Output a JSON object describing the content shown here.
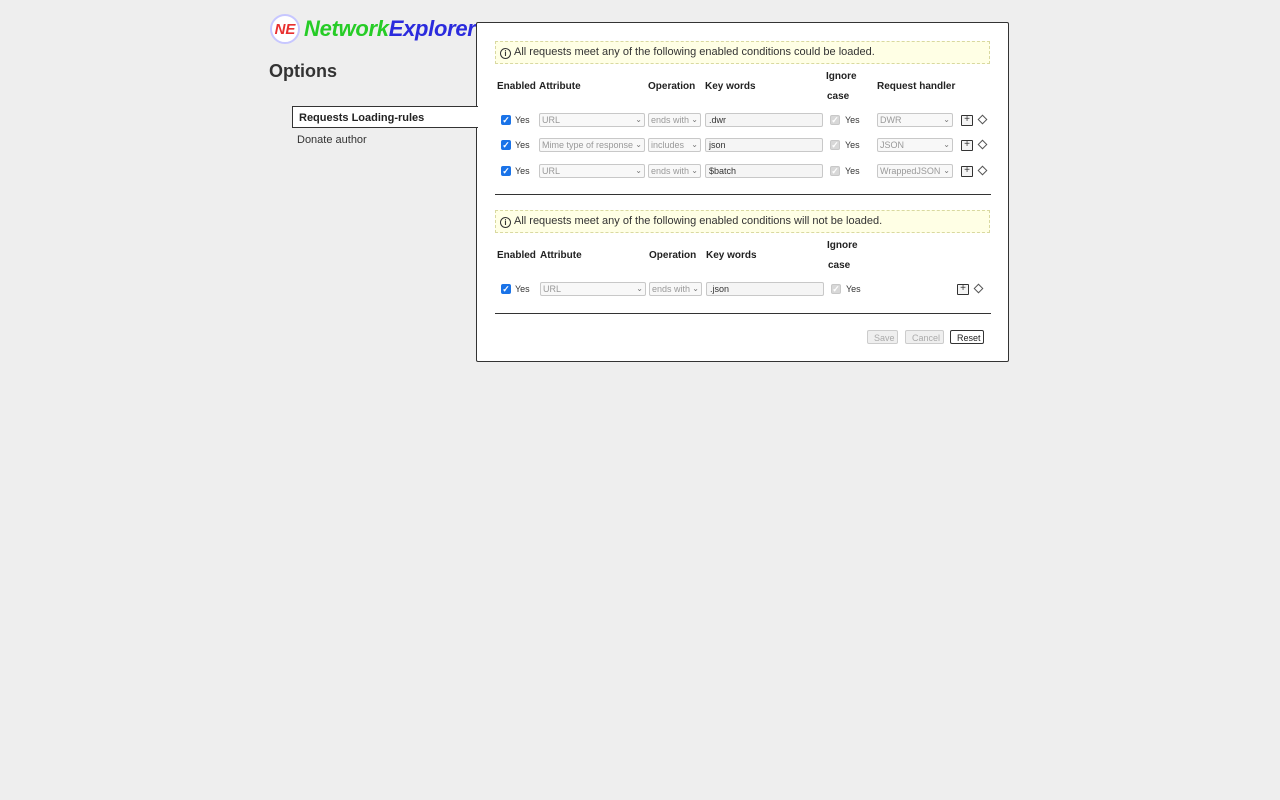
{
  "app": {
    "name_part1": "Network",
    "name_part2": "Explorer",
    "logo_mark": "NE"
  },
  "page_title": "Options",
  "nav": {
    "items": [
      {
        "label": "Requests Loading-rules"
      },
      {
        "label": "Donate author"
      }
    ]
  },
  "load_section": {
    "notice": "All requests meet any of the following enabled conditions could be loaded.",
    "headers": {
      "enabled": "Enabled",
      "attribute": "Attribute",
      "operation": "Operation",
      "keywords": "Key words",
      "ignore_case_1": "Ignore",
      "ignore_case_2": "case",
      "handler": "Request handler"
    },
    "rows": [
      {
        "enabled": "Yes",
        "attribute": "URL",
        "operation": "ends with",
        "keywords": ".dwr",
        "ignore_case": "Yes",
        "handler": "DWR"
      },
      {
        "enabled": "Yes",
        "attribute": "Mime type of response",
        "operation": "includes",
        "keywords": "json",
        "ignore_case": "Yes",
        "handler": "JSON"
      },
      {
        "enabled": "Yes",
        "attribute": "URL",
        "operation": "ends with",
        "keywords": "$batch",
        "ignore_case": "Yes",
        "handler": "WrappedJSON"
      }
    ]
  },
  "exclude_section": {
    "notice": "All requests meet any of the following enabled conditions will not be loaded.",
    "headers": {
      "enabled": "Enabled",
      "attribute": "Attribute",
      "operation": "Operation",
      "keywords": "Key words",
      "ignore_case_1": "Ignore",
      "ignore_case_2": "case"
    },
    "rows": [
      {
        "enabled": "Yes",
        "attribute": "URL",
        "operation": "ends with",
        "keywords": ".json",
        "ignore_case": "Yes"
      }
    ]
  },
  "buttons": {
    "save": "Save",
    "cancel": "Cancel",
    "reset": "Reset"
  },
  "icons": {
    "info": "info-icon",
    "add": "plus-icon",
    "move": "diamond-icon",
    "dropdown": "chevron-down-icon",
    "check": "checkmark-icon"
  },
  "glyphs": {
    "info": "i",
    "check": "✓",
    "chevron": "⌄",
    "plus": "+"
  },
  "colors": {
    "accent": "#1a73e8",
    "brand_green": "#26cc26",
    "brand_blue": "#2b2bdd",
    "notice_bg": "#ffffe5"
  }
}
